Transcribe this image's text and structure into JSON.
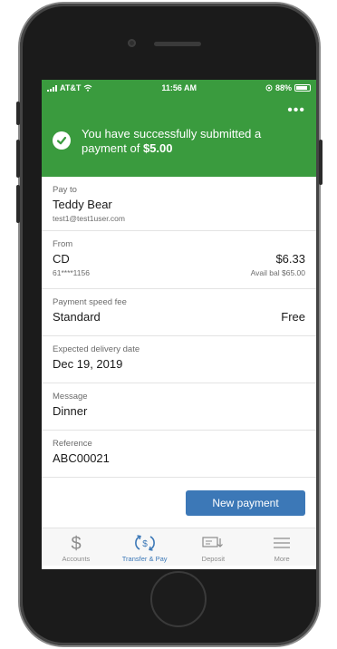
{
  "status_bar": {
    "carrier": "AT&T",
    "time": "11:56 AM",
    "battery": "88%"
  },
  "header": {
    "more_label": "•••"
  },
  "banner": {
    "message": "You have successfully submitted a payment of ",
    "amount": "$5.00"
  },
  "pay_to": {
    "label": "Pay to",
    "name": "Teddy Bear",
    "email": "test1@test1user.com"
  },
  "from": {
    "label": "From",
    "account": "CD",
    "amount": "$6.33",
    "masked": "61****1156",
    "available": "Avail bal $65.00"
  },
  "speed": {
    "label": "Payment speed fee",
    "value": "Standard",
    "fee": "Free"
  },
  "delivery": {
    "label": "Expected delivery date",
    "value": "Dec 19, 2019"
  },
  "message": {
    "label": "Message",
    "value": "Dinner"
  },
  "reference": {
    "label": "Reference",
    "value": "ABC00021"
  },
  "actions": {
    "new_payment_label": "New payment"
  },
  "tabs": [
    {
      "label": "Accounts",
      "icon": "dollar-icon"
    },
    {
      "label": "Transfer & Pay",
      "icon": "transfer-pay-icon"
    },
    {
      "label": "Deposit",
      "icon": "check-deposit-icon"
    },
    {
      "label": "More",
      "icon": "menu-icon"
    }
  ],
  "colors": {
    "header_green": "#3a9b3e",
    "accent_blue": "#3c78b7"
  }
}
